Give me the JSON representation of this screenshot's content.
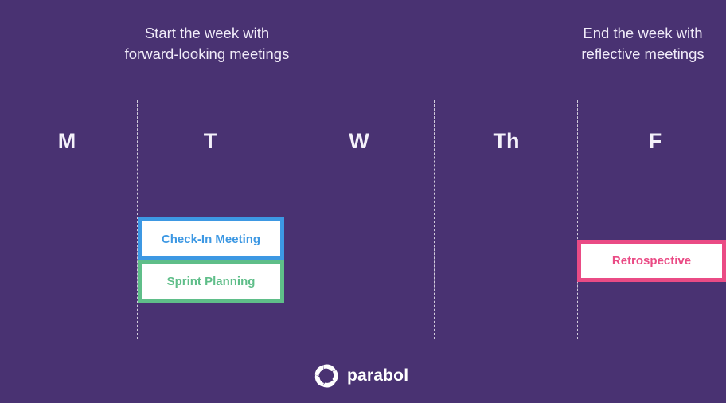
{
  "captions": {
    "start": {
      "line1": "Start the week with",
      "line2": "forward-looking meetings"
    },
    "end": {
      "line1": "End the week with",
      "line2": "reflective meetings"
    }
  },
  "days": [
    {
      "label": "M"
    },
    {
      "label": "T"
    },
    {
      "label": "W"
    },
    {
      "label": "Th"
    },
    {
      "label": "F"
    }
  ],
  "meetings": [
    {
      "label": "Check-In Meeting",
      "day": "T",
      "color": "#3d98e3"
    },
    {
      "label": "Sprint Planning",
      "day": "T",
      "color": "#5fbe89"
    },
    {
      "label": "Retrospective",
      "day": "F",
      "color": "#ea4b85"
    }
  ],
  "brand": {
    "name": "parabol",
    "icon": "parabol-logo-icon"
  },
  "colors": {
    "background": "#493272",
    "checkin": "#3d98e3",
    "sprint": "#5fbe89",
    "retro": "#ea4b85"
  }
}
